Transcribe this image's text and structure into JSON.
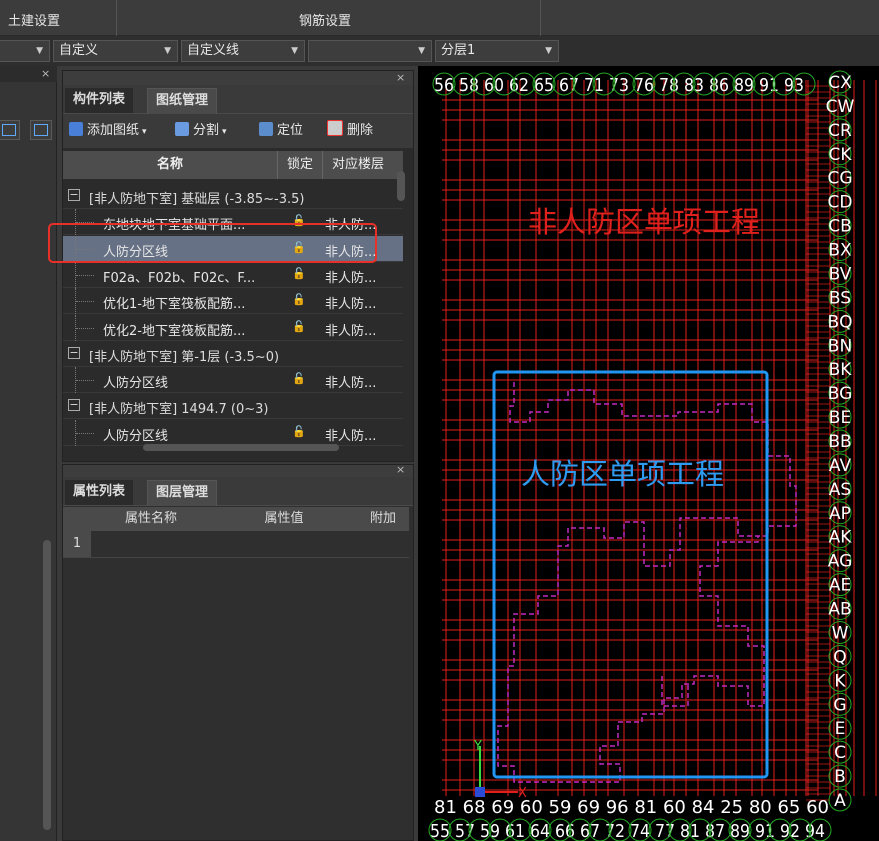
{
  "ribbon": {
    "tab1": "土建设置",
    "tab2": "钢筋设置"
  },
  "dropdowns": [
    {
      "value": ""
    },
    {
      "value": "自定义"
    },
    {
      "value": "自定义线"
    },
    {
      "value": ""
    },
    {
      "value": "分层1"
    }
  ],
  "component_panel": {
    "tabs": [
      "构件列表",
      "图纸管理"
    ],
    "active_tab": "图纸管理",
    "toolbar": {
      "add_drawing": "添加图纸",
      "split": "分割",
      "locate": "定位",
      "delete": "删除"
    },
    "columns": {
      "name": "名称",
      "lock": "锁定",
      "floor": "对应楼层"
    },
    "rows": [
      {
        "type": "group",
        "label": "[非人防地下室] 基础层 (-3.85~-3.5)"
      },
      {
        "type": "item",
        "label": "东地块地下室基础平面...",
        "floor": "非人防..."
      },
      {
        "type": "item",
        "label": "人防分区线",
        "floor": "非人防...",
        "selected": true
      },
      {
        "type": "item",
        "label": "F02a、F02b、F02c、F...",
        "floor": "非人防..."
      },
      {
        "type": "item",
        "label": "优化1-地下室筏板配筋...",
        "floor": "非人防..."
      },
      {
        "type": "item",
        "label": "优化2-地下室筏板配筋...",
        "floor": "非人防..."
      },
      {
        "type": "group",
        "label": "[非人防地下室] 第-1层 (-3.5~0)"
      },
      {
        "type": "item",
        "label": "人防分区线",
        "floor": "非人防..."
      },
      {
        "type": "group",
        "label": "[非人防地下室] 1494.7 (0~3)"
      },
      {
        "type": "item",
        "label": "人防分区线",
        "floor": "非人防..."
      }
    ]
  },
  "property_panel": {
    "tabs": [
      "属性列表",
      "图层管理"
    ],
    "columns": [
      "属性名称",
      "属性值",
      "附加"
    ],
    "rows": [
      {
        "index": "1"
      }
    ]
  },
  "canvas": {
    "label_non_civil": "非人防区单项工程",
    "label_civil": "人防区单项工程",
    "top_axis_text": "56 58 60 62 65 67 71 73 76 78 83 86 89 91 93",
    "bottom_axis_text_1": "81 68 69 60 59 69 96 81 60 84 25 80 65 60",
    "bottom_axis_text_2": "55 57 59 61 64 66 67 72 74 77 81 87 89 91 92 94",
    "right_axis_labels": [
      "CX",
      "CW",
      "CR",
      "CK",
      "CG",
      "CD",
      "CB",
      "BX",
      "BV",
      "BS",
      "BQ",
      "BN",
      "BK",
      "BG",
      "BE",
      "BB",
      "AV",
      "AS",
      "AP",
      "AK",
      "AG",
      "AE",
      "AB",
      "W",
      "Q",
      "K",
      "G",
      "E",
      "C",
      "B",
      "A"
    ],
    "axis_x": "X",
    "axis_y": "Y",
    "colors": {
      "grid": "#e0201c",
      "civil_box": "#2196f3",
      "boundary": "#c02bc0",
      "label_red": "#e0201c",
      "label_blue": "#2f9bf0",
      "axis_circle": "#25a825"
    }
  }
}
